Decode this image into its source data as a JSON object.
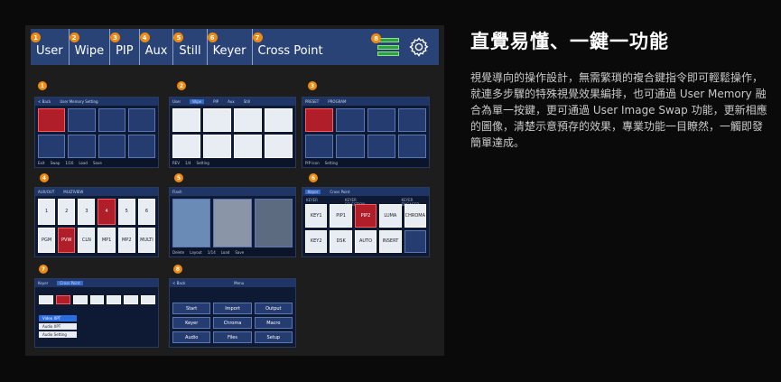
{
  "topbar": {
    "items": [
      {
        "num": "1",
        "label": "User"
      },
      {
        "num": "2",
        "label": "Wipe"
      },
      {
        "num": "3",
        "label": "PIP"
      },
      {
        "num": "4",
        "label": "Aux"
      },
      {
        "num": "5",
        "label": "Still"
      },
      {
        "num": "6",
        "label": "Keyer"
      },
      {
        "num": "7",
        "label": "Cross Point"
      }
    ],
    "status_badge": "8"
  },
  "thumbnails": [
    {
      "num": "1",
      "title": "User Memory Setting",
      "back": "< Back",
      "foot": [
        "Exit",
        "Swap",
        "1/16",
        "Load",
        "Save"
      ]
    },
    {
      "num": "2",
      "tabs": [
        "User",
        "Wipe",
        "PIP",
        "Aux",
        "Still"
      ],
      "foot": [
        "REV",
        "1/4",
        "Setting"
      ]
    },
    {
      "num": "3",
      "sections": [
        "PRESET",
        "PROGRAM"
      ],
      "foot": [
        "PIP Icon",
        "Setting"
      ]
    },
    {
      "num": "4",
      "sections": [
        "AUX/OUT",
        "MULTIVIEW"
      ],
      "cells": [
        "1",
        "2",
        "3",
        "4",
        "5",
        "6",
        "PGM",
        "PVW",
        "CLN",
        "MP1",
        "MP2",
        "MULTI"
      ]
    },
    {
      "num": "5",
      "label": "Flash",
      "foot": [
        "Delete",
        "Layout",
        "1/14",
        "Load",
        "Save"
      ]
    },
    {
      "num": "6",
      "tabs": [
        "Keyer",
        "Cross Point"
      ],
      "sections": [
        "KEYER",
        "KEYER SELECTION",
        "KEYER ENGAGED"
      ],
      "cells": [
        "KEY1",
        "KEY2",
        "DSK",
        "PIP1",
        "PIP2",
        "LUMA",
        "CHROMA",
        "AUTO",
        "INSERT"
      ]
    },
    {
      "num": "7",
      "tabs": [
        "Keyer",
        "Cross Point"
      ],
      "buttons": [
        "Video XPT",
        "Audio XPT",
        "Audio Setting"
      ]
    },
    {
      "num": "8",
      "title": "Menu",
      "back": "< Back",
      "items": [
        "Start",
        "Import",
        "Output",
        "Keyer",
        "Chroma",
        "Macro",
        "Audio",
        "Files",
        "Setup"
      ]
    }
  ],
  "headline": "直覺易懂、一鍵一功能",
  "description": "視覺導向的操作設計，無需繁瑣的複合鍵指令即可輕鬆操作，就連多步驟的特殊視覺效果編排，也可通過 User Memory 融合為單一按鍵，更可通過 User Image Swap 功能，更新相應的圖像，清楚示意預存的效果，專業功能一目瞭然，一觸即發簡單達成。",
  "colors": {
    "accent": "#f08a10",
    "topbar": "#2a4377",
    "screen": "#0e1a33"
  }
}
